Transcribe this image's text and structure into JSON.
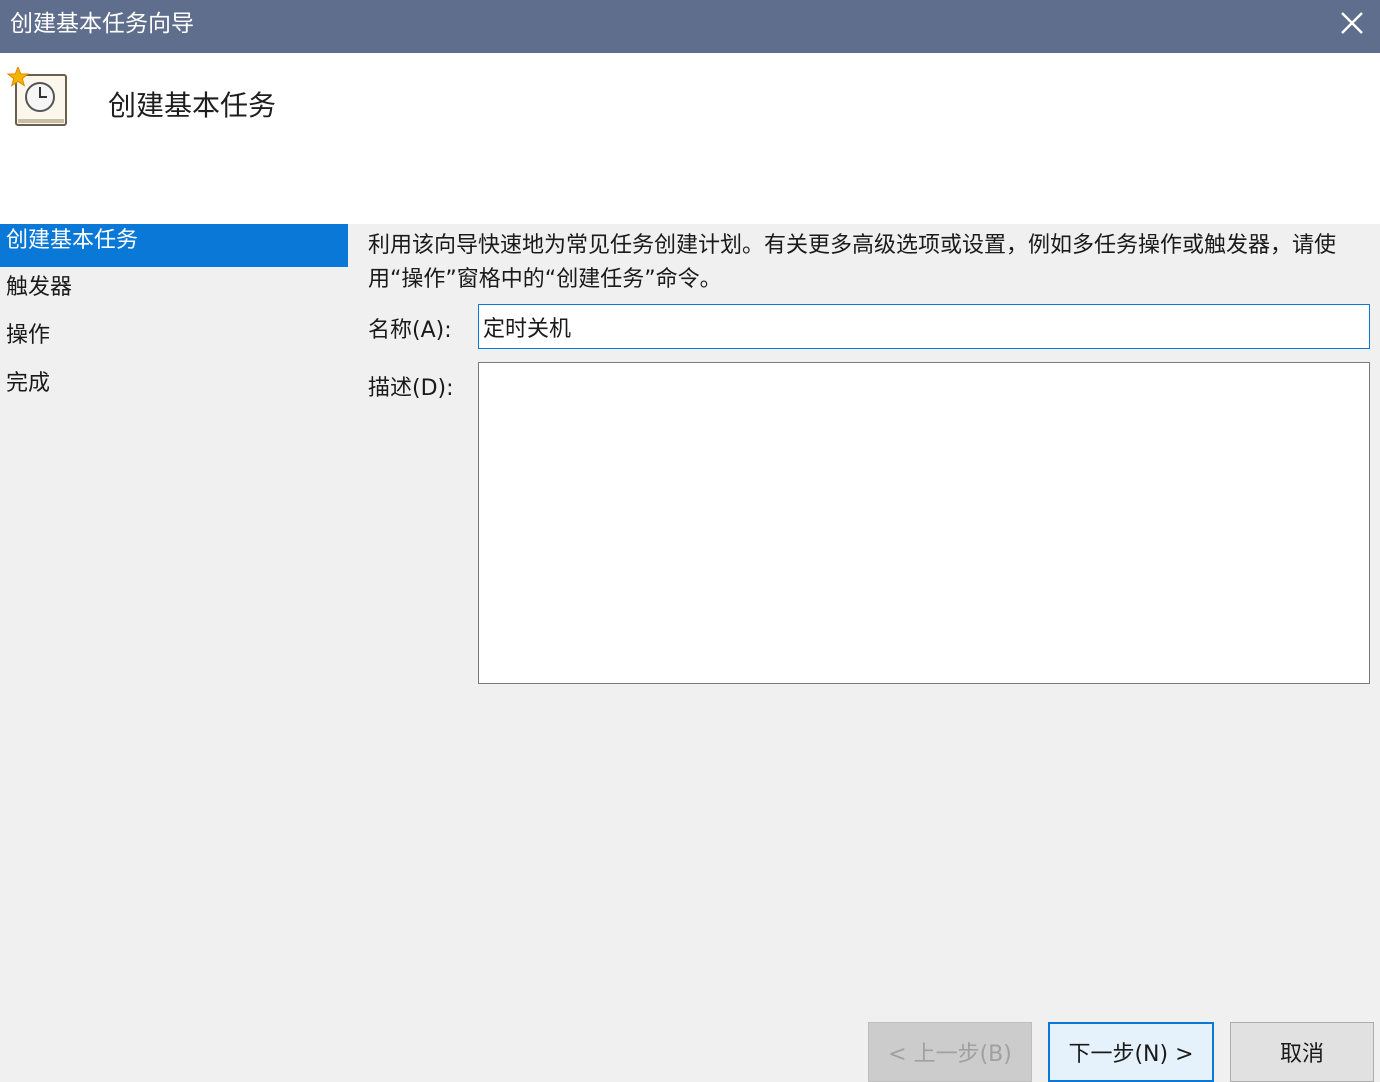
{
  "window": {
    "title": "创建基本任务向导",
    "close_icon": "close-icon"
  },
  "header": {
    "icon": "scheduled-task-clock-icon",
    "heading": "创建基本任务"
  },
  "nav": {
    "items": [
      {
        "label": "创建基本任务",
        "active": true
      },
      {
        "label": "触发器",
        "active": false
      },
      {
        "label": "操作",
        "active": false
      },
      {
        "label": "完成",
        "active": false
      }
    ]
  },
  "main": {
    "description": "利用该向导快速地为常见任务创建计划。有关更多高级选项或设置，例如多任务操作或触发器，请使用“操作”窗格中的“创建任务”命令。",
    "name_label": "名称(A):",
    "name_value": "定时关机",
    "desc_label": "描述(D):",
    "desc_value": ""
  },
  "buttons": {
    "back": "< 上一步(B)",
    "next": "下一步(N) >",
    "cancel": "取消"
  },
  "colors": {
    "titlebar": "#5f6e8c",
    "accent": "#0a78d7"
  }
}
